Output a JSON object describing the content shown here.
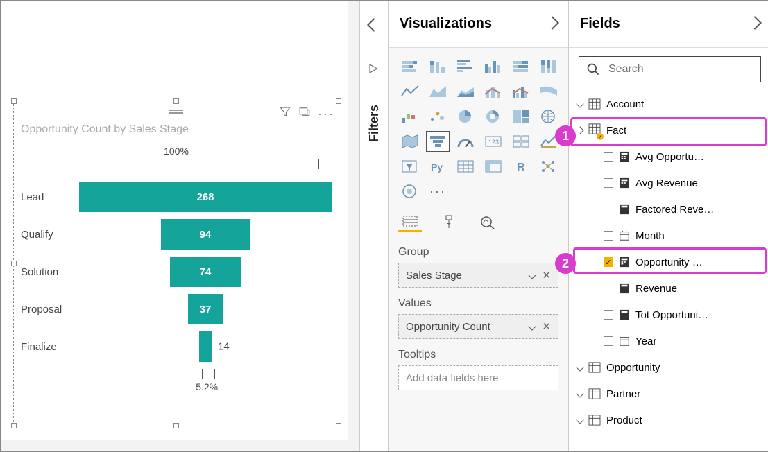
{
  "chart": {
    "title": "Opportunity Count by Sales Stage",
    "top_label": "100%",
    "bottom_label": "5.2%",
    "rows": [
      {
        "label": "Lead",
        "value": "268"
      },
      {
        "label": "Qualify",
        "value": "94"
      },
      {
        "label": "Solution",
        "value": "74"
      },
      {
        "label": "Proposal",
        "value": "37"
      },
      {
        "label": "Finalize",
        "value": "14"
      }
    ]
  },
  "chart_data": {
    "type": "bar",
    "title": "Opportunity Count by Sales Stage",
    "categories": [
      "Lead",
      "Qualify",
      "Solution",
      "Proposal",
      "Finalize"
    ],
    "values": [
      268,
      94,
      74,
      37,
      14
    ],
    "xlabel": "",
    "ylabel": "",
    "annotations": {
      "top_pct": "100%",
      "bottom_pct": "5.2%"
    }
  },
  "rail": {
    "filters": "Filters"
  },
  "viz": {
    "header": "Visualizations",
    "wells": {
      "group": {
        "label": "Group",
        "value": "Sales Stage"
      },
      "values": {
        "label": "Values",
        "value": "Opportunity Count"
      },
      "tooltips": {
        "label": "Tooltips",
        "placeholder": "Add data fields here"
      }
    }
  },
  "fields": {
    "header": "Fields",
    "search_placeholder": "Search",
    "tables": {
      "account": "Account",
      "fact": "Fact",
      "opportunity": "Opportunity",
      "partner": "Partner",
      "product": "Product"
    },
    "fact_cols": {
      "avg_opp": "Avg Opportu…",
      "avg_rev": "Avg Revenue",
      "fact_rev": "Factored Reve…",
      "month": "Month",
      "opp_count": "Opportunity …",
      "revenue": "Revenue",
      "tot_opp": "Tot Opportuni…",
      "year": "Year"
    }
  },
  "callouts": {
    "one": "1",
    "two": "2"
  }
}
